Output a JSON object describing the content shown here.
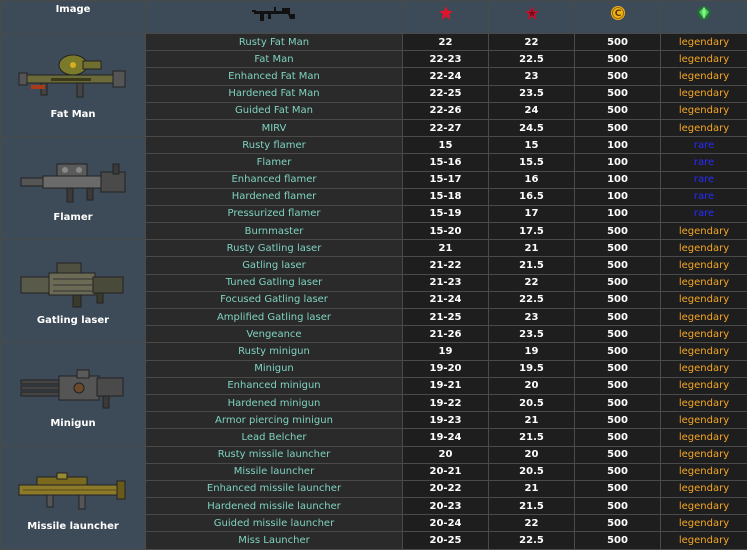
{
  "header": {
    "image_label": "Image",
    "columns": [
      {
        "icon": "rifle-icon"
      },
      {
        "icon": "red-star-icon",
        "color": "#e0142c"
      },
      {
        "icon": "red-star-dark-icon",
        "color": "#c9102a"
      },
      {
        "icon": "caps-coin-icon",
        "color": "#f0b21a"
      },
      {
        "icon": "green-gem-icon",
        "color": "#3fd44a"
      }
    ]
  },
  "colors": {
    "legendary": "#f5a623",
    "rare": "#2a2aff",
    "name": "#7fd3c0"
  },
  "groups": [
    {
      "name": "Fat Man",
      "icon": "fat-man-icon",
      "rows": [
        {
          "name": "Rusty Fat Man",
          "dmg": "22",
          "avg": "22",
          "cost": "500",
          "rarity": "legendary"
        },
        {
          "name": "Fat Man",
          "dmg": "22-23",
          "avg": "22.5",
          "cost": "500",
          "rarity": "legendary"
        },
        {
          "name": "Enhanced Fat Man",
          "dmg": "22-24",
          "avg": "23",
          "cost": "500",
          "rarity": "legendary"
        },
        {
          "name": "Hardened Fat Man",
          "dmg": "22-25",
          "avg": "23.5",
          "cost": "500",
          "rarity": "legendary"
        },
        {
          "name": "Guided Fat Man",
          "dmg": "22-26",
          "avg": "24",
          "cost": "500",
          "rarity": "legendary"
        },
        {
          "name": "MIRV",
          "dmg": "22-27",
          "avg": "24.5",
          "cost": "500",
          "rarity": "legendary"
        }
      ]
    },
    {
      "name": "Flamer",
      "icon": "flamer-icon",
      "rows": [
        {
          "name": "Rusty flamer",
          "dmg": "15",
          "avg": "15",
          "cost": "100",
          "rarity": "rare"
        },
        {
          "name": "Flamer",
          "dmg": "15-16",
          "avg": "15.5",
          "cost": "100",
          "rarity": "rare"
        },
        {
          "name": "Enhanced flamer",
          "dmg": "15-17",
          "avg": "16",
          "cost": "100",
          "rarity": "rare"
        },
        {
          "name": "Hardened flamer",
          "dmg": "15-18",
          "avg": "16.5",
          "cost": "100",
          "rarity": "rare"
        },
        {
          "name": "Pressurized flamer",
          "dmg": "15-19",
          "avg": "17",
          "cost": "100",
          "rarity": "rare"
        },
        {
          "name": "Burnmaster",
          "dmg": "15-20",
          "avg": "17.5",
          "cost": "500",
          "rarity": "legendary"
        }
      ]
    },
    {
      "name": "Gatling laser",
      "icon": "gatling-laser-icon",
      "rows": [
        {
          "name": "Rusty Gatling laser",
          "dmg": "21",
          "avg": "21",
          "cost": "500",
          "rarity": "legendary"
        },
        {
          "name": "Gatling laser",
          "dmg": "21-22",
          "avg": "21.5",
          "cost": "500",
          "rarity": "legendary"
        },
        {
          "name": "Tuned Gatling laser",
          "dmg": "21-23",
          "avg": "22",
          "cost": "500",
          "rarity": "legendary"
        },
        {
          "name": "Focused Gatling laser",
          "dmg": "21-24",
          "avg": "22.5",
          "cost": "500",
          "rarity": "legendary"
        },
        {
          "name": "Amplified Gatling laser",
          "dmg": "21-25",
          "avg": "23",
          "cost": "500",
          "rarity": "legendary"
        },
        {
          "name": "Vengeance",
          "dmg": "21-26",
          "avg": "23.5",
          "cost": "500",
          "rarity": "legendary"
        }
      ]
    },
    {
      "name": "Minigun",
      "icon": "minigun-icon",
      "rows": [
        {
          "name": "Rusty minigun",
          "dmg": "19",
          "avg": "19",
          "cost": "500",
          "rarity": "legendary"
        },
        {
          "name": "Minigun",
          "dmg": "19-20",
          "avg": "19.5",
          "cost": "500",
          "rarity": "legendary"
        },
        {
          "name": "Enhanced minigun",
          "dmg": "19-21",
          "avg": "20",
          "cost": "500",
          "rarity": "legendary"
        },
        {
          "name": "Hardened minigun",
          "dmg": "19-22",
          "avg": "20.5",
          "cost": "500",
          "rarity": "legendary"
        },
        {
          "name": "Armor piercing minigun",
          "dmg": "19-23",
          "avg": "21",
          "cost": "500",
          "rarity": "legendary"
        },
        {
          "name": "Lead Belcher",
          "dmg": "19-24",
          "avg": "21.5",
          "cost": "500",
          "rarity": "legendary"
        }
      ]
    },
    {
      "name": "Missile launcher",
      "icon": "missile-launcher-icon",
      "rows": [
        {
          "name": "Rusty missile launcher",
          "dmg": "20",
          "avg": "20",
          "cost": "500",
          "rarity": "legendary"
        },
        {
          "name": "Missile launcher",
          "dmg": "20-21",
          "avg": "20.5",
          "cost": "500",
          "rarity": "legendary"
        },
        {
          "name": "Enhanced missile launcher",
          "dmg": "20-22",
          "avg": "21",
          "cost": "500",
          "rarity": "legendary"
        },
        {
          "name": "Hardened missile launcher",
          "dmg": "20-23",
          "avg": "21.5",
          "cost": "500",
          "rarity": "legendary"
        },
        {
          "name": "Guided missile launcher",
          "dmg": "20-24",
          "avg": "22",
          "cost": "500",
          "rarity": "legendary"
        },
        {
          "name": "Miss Launcher",
          "dmg": "20-25",
          "avg": "22.5",
          "cost": "500",
          "rarity": "legendary"
        }
      ]
    }
  ]
}
